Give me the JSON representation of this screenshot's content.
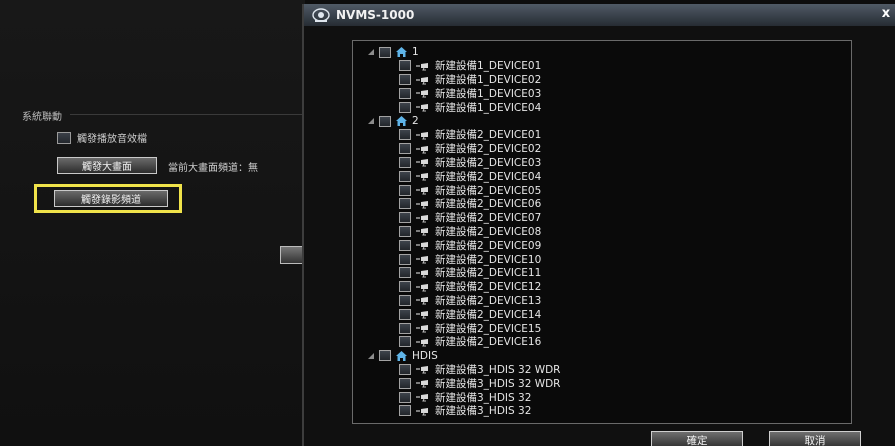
{
  "settings_panel": {
    "section_label": "系統聯動",
    "trigger_audio_label": "觸發播放音效檔",
    "trigger_big_screen_button": "觸發大畫面",
    "current_big_screen_channel": "當前大畫面頻道：無",
    "trigger_record_button": "觸發錄影頻道"
  },
  "dialog": {
    "title": "NVMS-1000",
    "close_symbol": "x",
    "ok_button": "確定",
    "cancel_button": "取消"
  },
  "tree": {
    "groups": [
      {
        "label": "1",
        "devices": [
          "新建設備1_DEVICE01",
          "新建設備1_DEVICE02",
          "新建設備1_DEVICE03",
          "新建設備1_DEVICE04"
        ]
      },
      {
        "label": "2",
        "devices": [
          "新建設備2_DEVICE01",
          "新建設備2_DEVICE02",
          "新建設備2_DEVICE03",
          "新建設備2_DEVICE04",
          "新建設備2_DEVICE05",
          "新建設備2_DEVICE06",
          "新建設備2_DEVICE07",
          "新建設備2_DEVICE08",
          "新建設備2_DEVICE09",
          "新建設備2_DEVICE10",
          "新建設備2_DEVICE11",
          "新建設備2_DEVICE12",
          "新建設備2_DEVICE13",
          "新建設備2_DEVICE14",
          "新建設備2_DEVICE15",
          "新建設備2_DEVICE16"
        ]
      },
      {
        "label": "HDIS",
        "devices": [
          "新建設備3_HDIS 32 WDR",
          "新建設備3_HDIS 32 WDR",
          "新建設備3_HDIS 32",
          "新建設備3_HDIS  32"
        ]
      }
    ]
  },
  "icons": {
    "title_icon": "camera-logo-icon",
    "group_icon": "home-icon",
    "device_icon": "camera-icon",
    "expander_icon": "expanded-triangle-icon"
  },
  "colors": {
    "highlight": "#f0e34a",
    "home_icon": "#5fb4e8",
    "background": "#0d0d0d"
  }
}
